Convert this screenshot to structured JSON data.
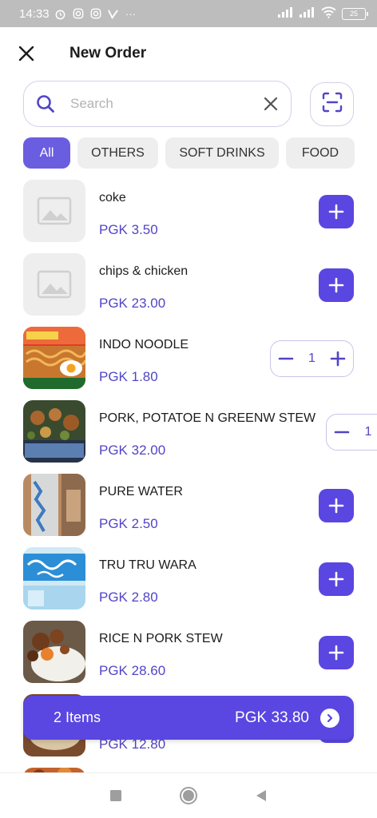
{
  "status_bar": {
    "time": "14:33",
    "battery": "25"
  },
  "header": {
    "title": "New Order"
  },
  "search": {
    "placeholder": "Search",
    "value": ""
  },
  "categories": [
    {
      "label": "All",
      "active": true
    },
    {
      "label": "OTHERS",
      "active": false
    },
    {
      "label": "SOFT DRINKS",
      "active": false
    },
    {
      "label": "FOOD",
      "active": false
    }
  ],
  "products": [
    {
      "name": "coke",
      "price": "PGK 3.50",
      "image": "placeholder",
      "control": "add"
    },
    {
      "name": "chips & chicken",
      "price": "PGK 23.00",
      "image": "placeholder",
      "control": "add"
    },
    {
      "name": "INDO NOODLE",
      "price": "PGK 1.80",
      "image": "noodles",
      "control": "stepper",
      "qty": "1"
    },
    {
      "name": "PORK, POTATOE N GREENW STEW",
      "price": "PGK 32.00",
      "image": "stew",
      "control": "stepper",
      "qty": "1"
    },
    {
      "name": "PURE WATER",
      "price": "PGK 2.50",
      "image": "water",
      "control": "add"
    },
    {
      "name": "TRU TRU WARA",
      "price": "PGK 2.80",
      "image": "wara",
      "control": "add"
    },
    {
      "name": "RICE N  PORK STEW",
      "price": "PGK 28.60",
      "image": "rice",
      "control": "add"
    },
    {
      "name": "",
      "price": "PGK 12.80",
      "image": "food",
      "control": "add"
    }
  ],
  "cart": {
    "items_label": "2 Items",
    "total": "PGK 33.80"
  },
  "colors": {
    "accent": "#5a46e0",
    "price": "#5145c6",
    "chip_active": "#6b5de0"
  }
}
